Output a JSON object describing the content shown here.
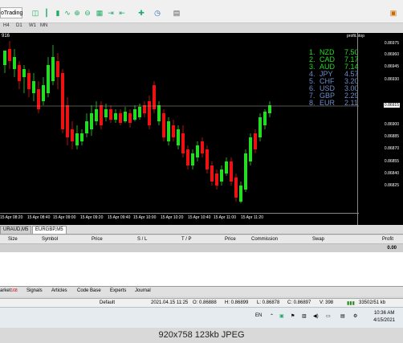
{
  "toolbar": {
    "app_label": "oTrading",
    "periods": [
      "H4",
      "D1",
      "W1",
      "MN"
    ]
  },
  "chart": {
    "title": "916",
    "tag": "profit.stop",
    "price_labels": [
      "0.86975",
      "0.86960",
      "0.86945",
      "0.86930",
      "0.86900",
      "0.86885",
      "0.86870",
      "0.86855",
      "0.86840",
      "0.86825"
    ],
    "current_price": "0.86915",
    "time_labels": [
      "15 Apr 08:20",
      "15 Apr 08:40",
      "15 Apr 09:00",
      "15 Apr 09:20",
      "15 Apr 09:40",
      "15 Apr 10:00",
      "15 Apr 10:20",
      "15 Apr 10:40",
      "15 Apr 11:00",
      "15 Apr 11:20"
    ],
    "colors": {
      "bull": "#22dd22",
      "bear": "#ee1111",
      "background": "#000000",
      "legend_green": "#22dd22",
      "legend_blue": "#6b8cc8"
    }
  },
  "legend": [
    {
      "rank": "1.",
      "currency": "NZD",
      "value": "7.50",
      "color": "#22dd22"
    },
    {
      "rank": "2.",
      "currency": "CAD",
      "value": "7.17",
      "color": "#22dd22"
    },
    {
      "rank": "3.",
      "currency": "AUD",
      "value": "7.14",
      "color": "#22dd22"
    },
    {
      "rank": "4.",
      "currency": "JPY",
      "value": "4.57",
      "color": "#6b8cc8"
    },
    {
      "rank": "5.",
      "currency": "CHF",
      "value": "3.20",
      "color": "#6b8cc8"
    },
    {
      "rank": "6.",
      "currency": "USD",
      "value": "3.00",
      "color": "#6b8cc8"
    },
    {
      "rank": "7.",
      "currency": "GBP",
      "value": "2.29",
      "color": "#6b8cc8"
    },
    {
      "rank": "8.",
      "currency": "EUR",
      "value": "2.11",
      "color": "#6b8cc8"
    }
  ],
  "symbol_tabs": [
    "URAUD,M5",
    "EURGBP,M5"
  ],
  "terminal": {
    "columns": [
      "Size",
      "Symbol",
      "Price",
      "S / L",
      "T / P",
      "Price",
      "Commission",
      "Swap",
      "Profit"
    ],
    "balance_value": "0.00"
  },
  "bottom_tabs": {
    "market": "arket",
    "market_badge": "168",
    "items": [
      "Signals",
      "Articles",
      "Code Base",
      "Experts",
      "Journal"
    ]
  },
  "status": {
    "profile": "Default",
    "datetime": "2021.04.15 11:25",
    "open": "O: 0.86888",
    "high": "H: 0.86899",
    "low": "L: 0.86878",
    "close": "C: 0.86897",
    "volume": "V: 398",
    "traffic": "33502/51 kb"
  },
  "taskbar": {
    "lang": "EN",
    "time": "10:36 AM",
    "date": "4/15/2021"
  },
  "caption": "920x758 123kb JPEG"
}
